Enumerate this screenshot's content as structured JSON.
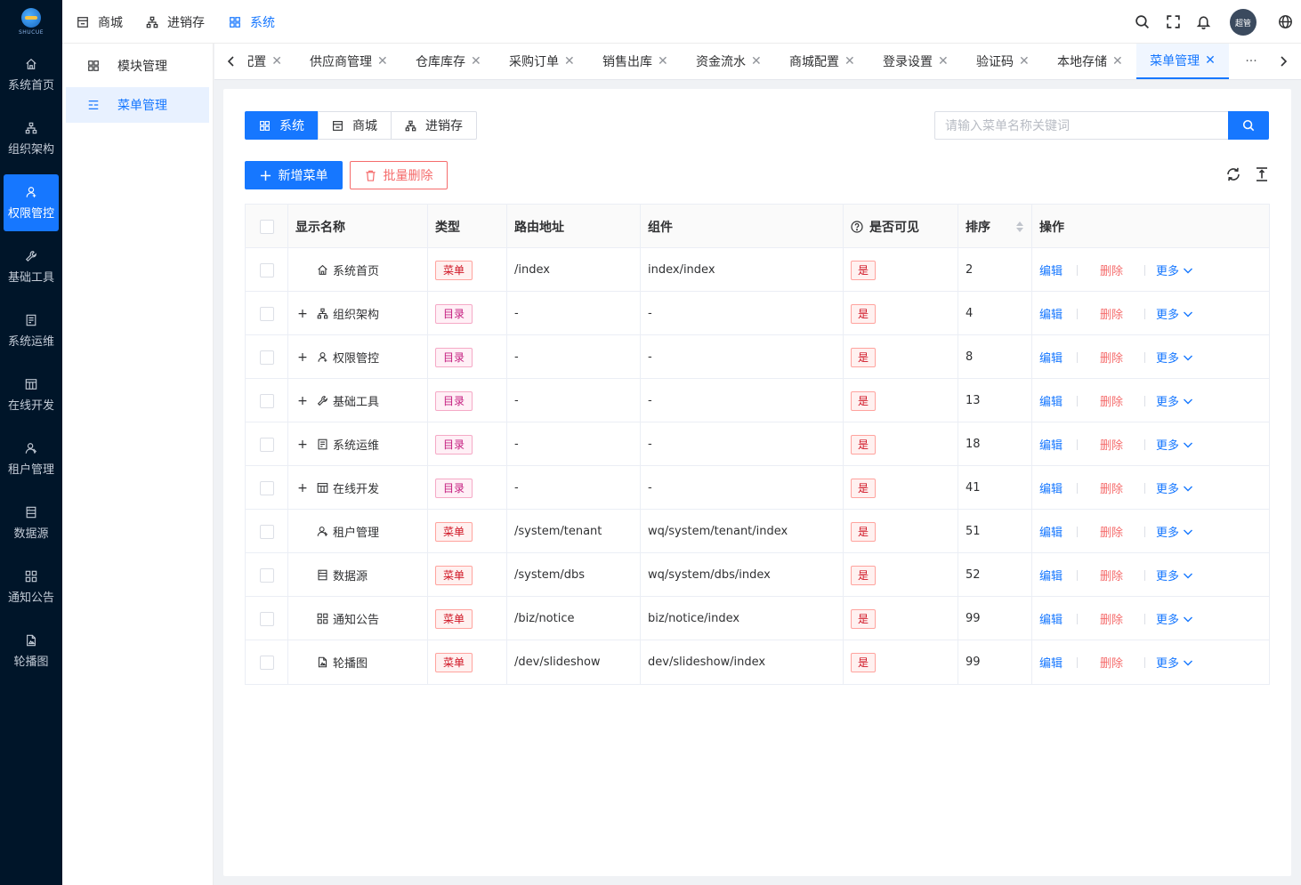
{
  "logo": {
    "text": "SHUCUE"
  },
  "left_nav": [
    {
      "label": "系统首页",
      "icon": "home-icon"
    },
    {
      "label": "组织架构",
      "icon": "org-icon"
    },
    {
      "label": "权限管控",
      "icon": "user-icon",
      "active": true
    },
    {
      "label": "基础工具",
      "icon": "tool-icon"
    },
    {
      "label": "系统运维",
      "icon": "ops-icon"
    },
    {
      "label": "在线开发",
      "icon": "dev-icon"
    },
    {
      "label": "租户管理",
      "icon": "tenant-icon"
    },
    {
      "label": "数据源",
      "icon": "datasource-icon"
    },
    {
      "label": "通知公告",
      "icon": "notice-icon"
    },
    {
      "label": "轮播图",
      "icon": "slideshow-icon"
    }
  ],
  "top_menu": [
    {
      "label": "商城",
      "icon": "store-icon"
    },
    {
      "label": "进销存",
      "icon": "org-icon"
    },
    {
      "label": "系统",
      "icon": "grid-icon",
      "active": true
    }
  ],
  "header": {
    "avatar_text": "超管"
  },
  "sub_nav": [
    {
      "label": "模块管理",
      "icon": "grid-icon"
    },
    {
      "label": "菜单管理",
      "icon": "menu-icon",
      "active": true
    }
  ],
  "tabs": [
    {
      "label": "配置"
    },
    {
      "label": "供应商管理"
    },
    {
      "label": "仓库库存"
    },
    {
      "label": "采购订单"
    },
    {
      "label": "销售出库"
    },
    {
      "label": "资金流水"
    },
    {
      "label": "商城配置"
    },
    {
      "label": "登录设置"
    },
    {
      "label": "验证码"
    },
    {
      "label": "本地存储"
    },
    {
      "label": "菜单管理",
      "active": true
    }
  ],
  "tabs_more": "···",
  "module_switch": [
    {
      "label": "系统",
      "icon": "grid-icon",
      "active": true
    },
    {
      "label": "商城",
      "icon": "store-icon"
    },
    {
      "label": "进销存",
      "icon": "org-icon"
    }
  ],
  "search": {
    "placeholder": "请输入菜单名称关键词",
    "value": ""
  },
  "actions": {
    "add_label": "新增菜单",
    "delete_label": "批量删除"
  },
  "table": {
    "columns": [
      "显示名称",
      "类型",
      "路由地址",
      "组件",
      "是否可见",
      "排序",
      "操作"
    ],
    "op_labels": {
      "edit": "编辑",
      "delete": "删除",
      "more": "更多"
    },
    "rows": [
      {
        "name": "系统首页",
        "icon": "home-icon",
        "expandable": false,
        "type": "菜单",
        "route": "/index",
        "component": "index/index",
        "visible": "是",
        "sort": "2"
      },
      {
        "name": "组织架构",
        "icon": "org-icon",
        "expandable": true,
        "type": "目录",
        "route": "-",
        "component": "-",
        "visible": "是",
        "sort": "4"
      },
      {
        "name": "权限管控",
        "icon": "user-icon",
        "expandable": true,
        "type": "目录",
        "route": "-",
        "component": "-",
        "visible": "是",
        "sort": "8"
      },
      {
        "name": "基础工具",
        "icon": "tool-icon",
        "expandable": true,
        "type": "目录",
        "route": "-",
        "component": "-",
        "visible": "是",
        "sort": "13"
      },
      {
        "name": "系统运维",
        "icon": "ops-icon",
        "expandable": true,
        "type": "目录",
        "route": "-",
        "component": "-",
        "visible": "是",
        "sort": "18"
      },
      {
        "name": "在线开发",
        "icon": "dev-icon",
        "expandable": true,
        "type": "目录",
        "route": "-",
        "component": "-",
        "visible": "是",
        "sort": "41"
      },
      {
        "name": "租户管理",
        "icon": "tenant-icon",
        "expandable": false,
        "type": "菜单",
        "route": "/system/tenant",
        "component": "wq/system/tenant/index",
        "visible": "是",
        "sort": "51"
      },
      {
        "name": "数据源",
        "icon": "datasource-icon",
        "expandable": false,
        "type": "菜单",
        "route": "/system/dbs",
        "component": "wq/system/dbs/index",
        "visible": "是",
        "sort": "52"
      },
      {
        "name": "通知公告",
        "icon": "notice-icon",
        "expandable": false,
        "type": "菜单",
        "route": "/biz/notice",
        "component": "biz/notice/index",
        "visible": "是",
        "sort": "99"
      },
      {
        "name": "轮播图",
        "icon": "slideshow-icon",
        "expandable": false,
        "type": "菜单",
        "route": "/dev/slideshow",
        "component": "dev/slideshow/index",
        "visible": "是",
        "sort": "99"
      }
    ]
  },
  "colors": {
    "accent": "#1677ff",
    "nav_bg": "#001529",
    "danger": "#f56c6c",
    "tag_pink": "#c41d7f",
    "tag_red": "#cf1322"
  }
}
